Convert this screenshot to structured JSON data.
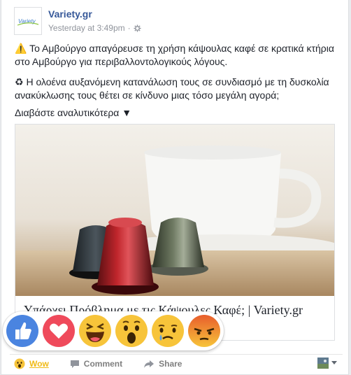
{
  "post": {
    "page_name": "Variety.gr",
    "avatar_text": "Variety",
    "timestamp": "Yesterday at 3:49pm",
    "separator": "·",
    "line1": "⚠️ Το Αμβούργο απαγόρευσε τη χρήση κάψουλας καφέ σε κρατικά κτήρια στο Αμβούργο για περιβαλλοντολογικούς λόγους.",
    "line2": "♻ Η ολοένα αυξανόμενη κατανάλωση τους σε συνδιασμό με τη δυσκολία ανακύκλωσης τους θέτει σε κίνδυνο μιας τόσο μεγάλη αγορά;",
    "read_more": "Διαβάστε αναλυτικότερα ▼"
  },
  "link": {
    "title": "Υπάρχει Πρόβλημα με τις Κάψουλες Καφέ; | Variety.gr"
  },
  "reactions": [
    "like",
    "love",
    "haha",
    "wow",
    "sad",
    "angry"
  ],
  "actions": {
    "wow_label": "Wow",
    "comment_label": "Comment",
    "share_label": "Share"
  },
  "colors": {
    "link_blue": "#365899",
    "wow_yellow": "#f0ba15",
    "like_blue": "#4a84e0",
    "love_red": "#ef4a5b",
    "angry_orange": "#e85d2c"
  }
}
